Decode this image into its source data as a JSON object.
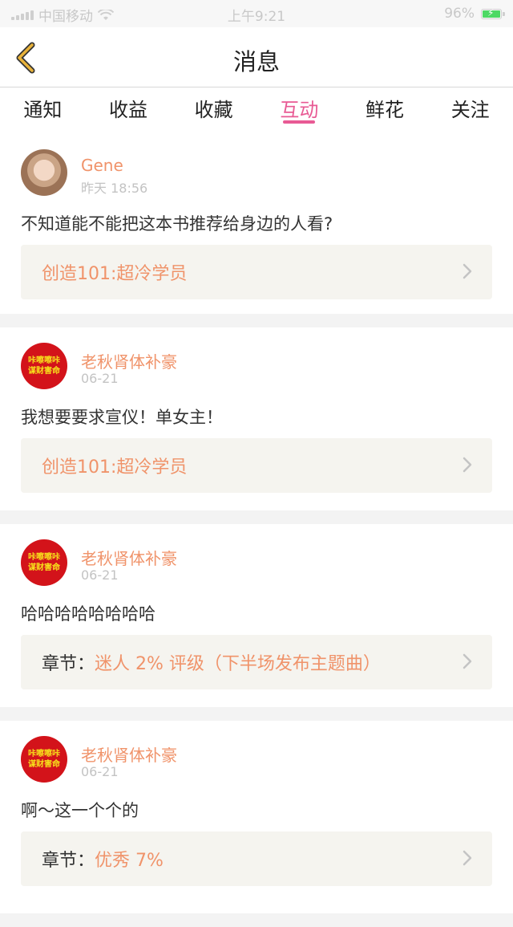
{
  "status_bar": {
    "carrier": "中国移动",
    "time": "上午9:21",
    "battery": "96%"
  },
  "nav": {
    "title": "消息"
  },
  "tabs": [
    {
      "label": "通知",
      "active": false
    },
    {
      "label": "收益",
      "active": false
    },
    {
      "label": "收藏",
      "active": false
    },
    {
      "label": "互动",
      "active": true
    },
    {
      "label": "鲜花",
      "active": false
    },
    {
      "label": "关注",
      "active": false
    }
  ],
  "messages": [
    {
      "user": "Gene",
      "time": "昨天 18:56",
      "text": "不知道能不能把这本书推荐给身边的人看?",
      "link_prefix": "",
      "link_text": "创造101:超冷学员",
      "avatar": "photo"
    },
    {
      "user": "老秋肾体补豪",
      "time": "06-21",
      "text": "我想要要求宣仪！单女主！",
      "link_prefix": "",
      "link_text": "创造101:超冷学员",
      "avatar": "seal",
      "avatar_text": [
        "咔嚓嚓咔",
        "谋财害命"
      ]
    },
    {
      "user": "老秋肾体补豪",
      "time": "06-21",
      "text": "哈哈哈哈哈哈哈哈",
      "link_prefix": "章节：",
      "link_text": "迷人 2% 评级（下半场发布主题曲）",
      "avatar": "seal",
      "avatar_text": [
        "咔嚓嚓咔",
        "谋财害命"
      ]
    },
    {
      "user": "老秋肾体补豪",
      "time": "06-21",
      "text": "啊～这一个个的",
      "link_prefix": "章节：",
      "link_text": "优秀 7%",
      "avatar": "seal",
      "avatar_text": [
        "咔嚓嚓咔",
        "谋财害命"
      ]
    }
  ],
  "colors": {
    "accent": "#e85a94",
    "username": "#f0936a",
    "back_arrow": "#e8b23a"
  }
}
